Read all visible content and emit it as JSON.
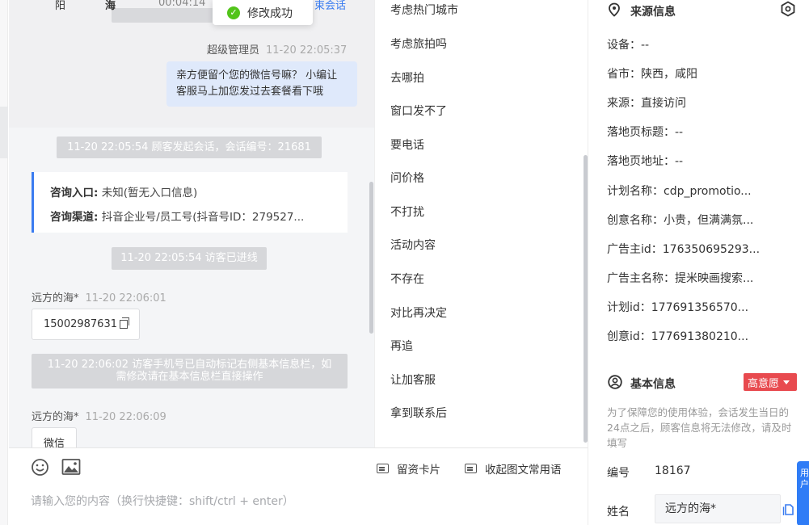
{
  "chat": {
    "top_row": {
      "col1": "阳",
      "col2": "海",
      "col3": "00:04:14",
      "col4": "束会话"
    },
    "toast": "修改成功",
    "admin_sender": "超级管理员",
    "admin_time": "11-20 22:05:37",
    "admin_message": "亲方便留个您的微信号嘛？ 小编让客服马上加您发过去套餐看下哦",
    "sys_start": "11-20 22:05:54 顾客发起会话，会话编号：21681",
    "card": {
      "entry_label": "咨询入口:",
      "entry_value": "未知(暂无入口信息)",
      "channel_label": "咨询渠道:",
      "channel_value": "抖音企业号/员工号(抖音号ID：279527..."
    },
    "sys_online": "11-20 22:05:54 访客已进线",
    "visitor_name": "远方的海*",
    "visitor_time_1": "11-20 22:06:01",
    "visitor_phone": "15002987631",
    "sys_phone_mark": "11-20 22:06:02 访客手机号已自动标记右侧基本信息栏，如需修改请在基本信息栏直接操作",
    "visitor_time_2": "11-20 22:06:09",
    "visitor_msg_2": "微信"
  },
  "input": {
    "card_label": "留资卡片",
    "collapse_label": "收起图文常用语",
    "placeholder": "请输入您的内容（换行快捷键：shift/ctrl + enter）"
  },
  "phrases": [
    "考虑热门城市",
    "考虑旅拍吗",
    "去哪拍",
    "窗口发不了",
    "要电话",
    "问价格",
    "不打扰",
    "活动内容",
    "不存在",
    "对比再决定",
    "再追",
    "让加客服",
    "拿到联系后"
  ],
  "source": {
    "title": "来源信息",
    "rows": [
      "设备：--",
      "省市：陕西，咸阳",
      "来源：直接访问",
      "落地页标题：--",
      "落地页地址：--",
      "计划名称：cdp_promotio...",
      "创意名称：小贵，但满满氛...",
      "广告主id：176350695293...",
      "广告主名称：提米映画搜索...",
      "计划id：177691356570...",
      "创意id：177691380210..."
    ]
  },
  "basic": {
    "title": "基本信息",
    "badge": "高意愿",
    "notice": "为了保障您的使用体验，会话发生当日的24点之后，顾客信息将无法修改，请及时填写",
    "id_label": "编号",
    "id_value": "18167",
    "name_label": "姓名",
    "name_value": "远方的海*"
  },
  "float_tab": "用户"
}
